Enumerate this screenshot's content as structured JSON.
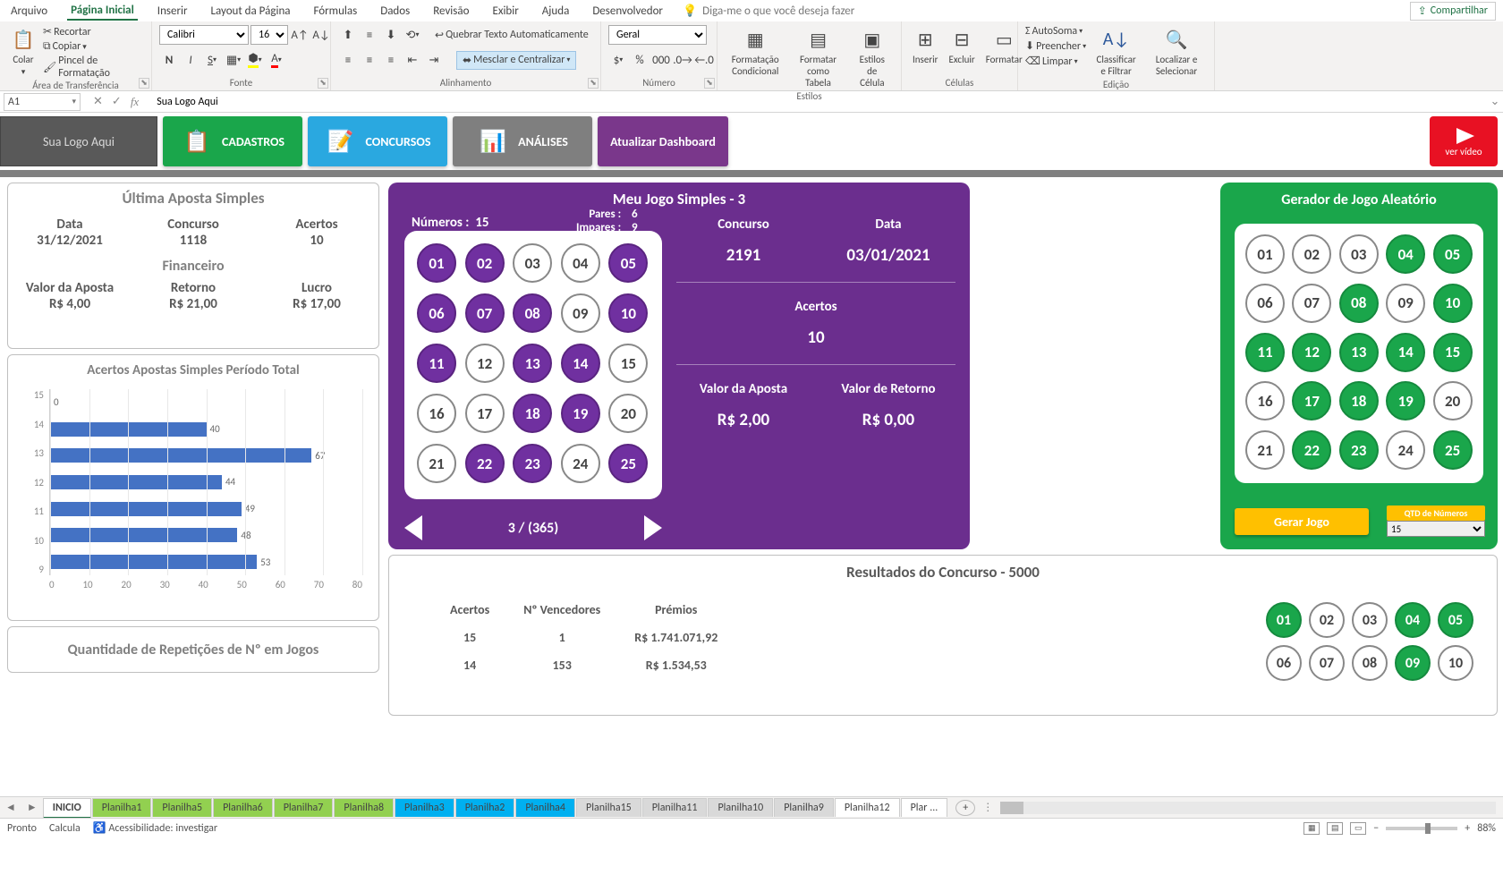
{
  "menubar": {
    "tabs": [
      "Arquivo",
      "Página Inicial",
      "Inserir",
      "Layout da Página",
      "Fórmulas",
      "Dados",
      "Revisão",
      "Exibir",
      "Ajuda",
      "Desenvolvedor"
    ],
    "active_index": 1,
    "tell_me": "Diga-me o que você deseja fazer",
    "share": "Compartilhar"
  },
  "ribbon": {
    "paste": "Colar",
    "cut": "Recortar",
    "copy": "Copiar",
    "format_painter": "Pincel de Formatação",
    "clipboard_label": "Área de Transferência",
    "font_name": "Calibri",
    "font_size": "16",
    "font_label": "Fonte",
    "wrap": "Quebrar Texto Automaticamente",
    "merge": "Mesclar e Centralizar",
    "align_label": "Alinhamento",
    "num_format": "Geral",
    "num_label": "Número",
    "cond_format": "Formatação Condicional",
    "format_table": "Formatar como Tabela",
    "cell_styles": "Estilos de Célula",
    "styles_label": "Estilos",
    "insert": "Inserir",
    "delete": "Excluir",
    "format": "Formatar",
    "cells_label": "Células",
    "autosum": "AutoSoma",
    "fill": "Preencher",
    "clear": "Limpar",
    "sort": "Classificar e Filtrar",
    "find": "Localizar e Selecionar",
    "edit_label": "Edição"
  },
  "formula_bar": {
    "cell": "A1",
    "value": "Sua Logo Aqui"
  },
  "dash_buttons": {
    "logo": "Sua Logo Aqui",
    "b1": "CADASTROS",
    "b2": "CONCURSOS",
    "b3": "ANÁLISES",
    "b4": "Atualizar Dashboard",
    "yt": "ver vídeo"
  },
  "ultima": {
    "title": "Última Aposta Simples",
    "h_data": "Data",
    "v_data": "31/12/2021",
    "h_conc": "Concurso",
    "v_conc": "1118",
    "h_acertos": "Acertos",
    "v_acertos": "10",
    "fin": "Financeiro",
    "h_valor": "Valor da Aposta",
    "v_valor": "R$ 4,00",
    "h_ret": "Retorno",
    "v_ret": "R$ 21,00",
    "h_lucro": "Lucro",
    "v_lucro": "R$ 17,00"
  },
  "chart_data": {
    "type": "bar",
    "orientation": "horizontal",
    "title": "Acertos Apostas Simples Período Total",
    "categories": [
      "15",
      "14",
      "13",
      "12",
      "11",
      "10",
      "9"
    ],
    "values": [
      0,
      40,
      67,
      44,
      49,
      48,
      53
    ],
    "xlim": [
      0,
      80
    ],
    "x_ticks": [
      0,
      10,
      20,
      30,
      40,
      50,
      60,
      70,
      80
    ]
  },
  "rep_title": "Quantidade de Repetições de Nº em Jogos",
  "jogo": {
    "title": "Meu Jogo Simples - 3",
    "numeros_lbl": "Números :",
    "numeros_v": "15",
    "pares_lbl": "Pares :",
    "pares_v": "6",
    "impares_lbl": "Impares :",
    "impares_v": "9",
    "concurso_lbl": "Concurso",
    "concurso_v": "2191",
    "data_lbl": "Data",
    "data_v": "03/01/2021",
    "acertos_lbl": "Acertos",
    "acertos_v": "10",
    "valor_ap_lbl": "Valor da Aposta",
    "valor_ap_v": "R$ 2,00",
    "valor_ret_lbl": "Valor de Retorno",
    "valor_ret_v": "R$ 0,00",
    "pager": "3 / (365)",
    "selected": [
      1,
      2,
      5,
      6,
      7,
      8,
      10,
      11,
      13,
      14,
      18,
      19,
      22,
      23,
      25
    ]
  },
  "gerador": {
    "title": "Gerador de Jogo Aleatório",
    "btn": "Gerar Jogo",
    "qtd_lbl": "QTD de Números",
    "qtd_v": "15",
    "selected": [
      4,
      5,
      8,
      10,
      11,
      12,
      13,
      14,
      15,
      17,
      18,
      19,
      22,
      23,
      25
    ]
  },
  "resultados": {
    "title": "Resultados do Concurso - 5000",
    "h1": "Acertos",
    "h2": "Nº Vencedores",
    "h3": "Prémios",
    "rows": [
      {
        "a": "15",
        "n": "1",
        "p": "R$ 1.741.071,92"
      },
      {
        "a": "14",
        "n": "153",
        "p": "R$ 1.534,53"
      }
    ],
    "selected": [
      1,
      4,
      5,
      9
    ]
  },
  "sheets": {
    "tabs": [
      {
        "name": "INICIO",
        "cls": "active"
      },
      {
        "name": "Planilha1",
        "cls": "green"
      },
      {
        "name": "Planilha5",
        "cls": "green"
      },
      {
        "name": "Planilha6",
        "cls": "green"
      },
      {
        "name": "Planilha7",
        "cls": "green"
      },
      {
        "name": "Planilha8",
        "cls": "green"
      },
      {
        "name": "Planilha3",
        "cls": "blue"
      },
      {
        "name": "Planilha2",
        "cls": "blue"
      },
      {
        "name": "Planilha4",
        "cls": "blue"
      },
      {
        "name": "Planilha15",
        "cls": "gray"
      },
      {
        "name": "Planilha11",
        "cls": "gray"
      },
      {
        "name": "Planilha10",
        "cls": "gray"
      },
      {
        "name": "Planilha9",
        "cls": "gray"
      },
      {
        "name": "Planilha12",
        "cls": ""
      },
      {
        "name": "Plar ...",
        "cls": ""
      }
    ]
  },
  "status": {
    "ready": "Pronto",
    "calc": "Calcula",
    "acc": "Acessibilidade: investigar",
    "zoom": "88%"
  }
}
